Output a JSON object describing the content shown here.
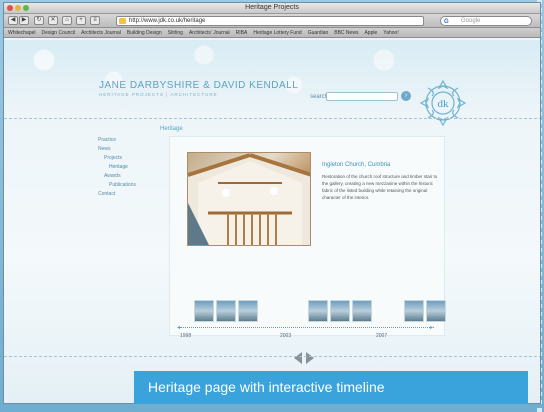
{
  "window": {
    "title": "Heritage Projects",
    "url": "http://www.jdk.co.uk/heritage",
    "search_placeholder": "Google"
  },
  "bookmarks": [
    "Whitechapel",
    "Design Council",
    "Architects Journal",
    "Building Design",
    "Stirling",
    "Architects' Journal",
    "RIBA",
    "Heritage Lottery Fund",
    "Guardian",
    "BBC News",
    "Apple",
    "Yahoo!"
  ],
  "site": {
    "title": "JANE DARBYSHIRE & DAVID KENDALL",
    "subtitle": "HERITAGE PROJECTS | ARCHITECTURE",
    "search_label": "search"
  },
  "leftnav": [
    {
      "label": "Practice",
      "level": 0
    },
    {
      "label": "News",
      "level": 0
    },
    {
      "label": "Projects",
      "level": 1
    },
    {
      "label": "Heritage",
      "level": 2,
      "active": true
    },
    {
      "label": "Awards",
      "level": 1
    },
    {
      "label": "Publications",
      "level": 2
    },
    {
      "label": "Contact",
      "level": 0
    }
  ],
  "content": {
    "section": "Heritage",
    "entry_title": "Ingleton Church, Cumbria",
    "entry_text": "Restoration of the church roof structure and timber stair to the gallery, creating a new mezzanine within the historic fabric of the listed building while retaining the original character of the interior."
  },
  "timeline": {
    "years": [
      "1998",
      "2003",
      "2007"
    ]
  },
  "caption": "Heritage page with interactive timeline",
  "colors": {
    "accent": "#3aa3dc",
    "site_blue": "#5fa2c1"
  }
}
